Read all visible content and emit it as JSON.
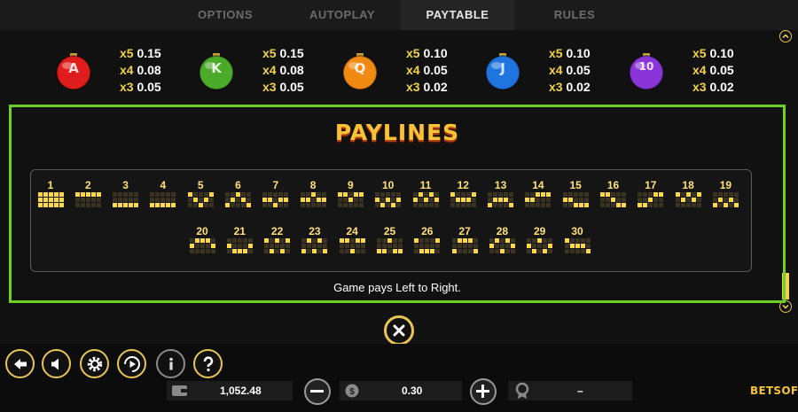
{
  "tabs": [
    {
      "label": "OPTIONS",
      "active": false
    },
    {
      "label": "AUTOPLAY",
      "active": false
    },
    {
      "label": "PAYTABLE",
      "active": true
    },
    {
      "label": "RULES",
      "active": false
    }
  ],
  "symbols": [
    {
      "icon": "red-ornament-a-icon",
      "color": "#e01d1d",
      "letter": "A",
      "pays": [
        {
          "mult": "x5",
          "value": "0.15"
        },
        {
          "mult": "x4",
          "value": "0.08"
        },
        {
          "mult": "x3",
          "value": "0.05"
        }
      ]
    },
    {
      "icon": "green-ornament-k-icon",
      "color": "#4caa2a",
      "letter": "K",
      "pays": [
        {
          "mult": "x5",
          "value": "0.15"
        },
        {
          "mult": "x4",
          "value": "0.08"
        },
        {
          "mult": "x3",
          "value": "0.05"
        }
      ]
    },
    {
      "icon": "orange-ornament-q-icon",
      "color": "#f08a12",
      "letter": "Q",
      "pays": [
        {
          "mult": "x5",
          "value": "0.10"
        },
        {
          "mult": "x4",
          "value": "0.05"
        },
        {
          "mult": "x3",
          "value": "0.02"
        }
      ]
    },
    {
      "icon": "blue-ornament-j-icon",
      "color": "#1f74e0",
      "letter": "J",
      "pays": [
        {
          "mult": "x5",
          "value": "0.10"
        },
        {
          "mult": "x4",
          "value": "0.05"
        },
        {
          "mult": "x3",
          "value": "0.02"
        }
      ]
    },
    {
      "icon": "purple-ornament-10-icon",
      "color": "#8a35d8",
      "letter": "10",
      "pays": [
        {
          "mult": "x5",
          "value": "0.10"
        },
        {
          "mult": "x4",
          "value": "0.05"
        },
        {
          "mult": "x3",
          "value": "0.02"
        }
      ]
    }
  ],
  "paylines_title": "PAYLINES",
  "paylines": [
    {
      "n": "1",
      "rows": [
        1,
        1,
        1,
        1,
        1
      ]
    },
    {
      "n": "2",
      "rows": [
        0,
        0,
        0,
        0,
        0
      ]
    },
    {
      "n": "3",
      "rows": [
        2,
        2,
        2,
        2,
        2
      ]
    },
    {
      "n": "4",
      "rows": [
        2,
        2,
        2,
        2,
        2
      ]
    },
    {
      "n": "5",
      "rows": [
        0,
        1,
        2,
        1,
        0
      ]
    },
    {
      "n": "6",
      "rows": [
        2,
        1,
        0,
        1,
        2
      ]
    },
    {
      "n": "7",
      "rows": [
        1,
        1,
        2,
        1,
        1
      ]
    },
    {
      "n": "8",
      "rows": [
        1,
        1,
        0,
        1,
        1
      ]
    },
    {
      "n": "9",
      "rows": [
        0,
        0,
        1,
        0,
        0
      ]
    },
    {
      "n": "10",
      "rows": [
        1,
        2,
        1,
        2,
        1
      ]
    },
    {
      "n": "11",
      "rows": [
        1,
        0,
        1,
        0,
        1
      ]
    },
    {
      "n": "12",
      "rows": [
        0,
        1,
        1,
        1,
        0
      ]
    },
    {
      "n": "13",
      "rows": [
        2,
        1,
        1,
        1,
        2
      ]
    },
    {
      "n": "14",
      "rows": [
        1,
        1,
        0,
        0,
        0
      ]
    },
    {
      "n": "15",
      "rows": [
        1,
        1,
        2,
        2,
        2
      ]
    },
    {
      "n": "16",
      "rows": [
        0,
        0,
        1,
        2,
        2
      ]
    },
    {
      "n": "17",
      "rows": [
        2,
        2,
        1,
        0,
        0
      ]
    },
    {
      "n": "18",
      "rows": [
        0,
        1,
        0,
        1,
        0
      ]
    },
    {
      "n": "19",
      "rows": [
        2,
        1,
        2,
        1,
        2
      ]
    },
    {
      "n": "20",
      "rows": [
        1,
        0,
        0,
        0,
        1
      ]
    },
    {
      "n": "21",
      "rows": [
        1,
        2,
        2,
        2,
        1
      ]
    },
    {
      "n": "22",
      "rows": [
        0,
        2,
        0,
        2,
        0
      ]
    },
    {
      "n": "23",
      "rows": [
        2,
        0,
        2,
        0,
        2
      ]
    },
    {
      "n": "24",
      "rows": [
        0,
        0,
        2,
        0,
        0
      ]
    },
    {
      "n": "25",
      "rows": [
        2,
        2,
        0,
        2,
        2
      ]
    },
    {
      "n": "26",
      "rows": [
        0,
        2,
        2,
        2,
        0
      ]
    },
    {
      "n": "27",
      "rows": [
        2,
        0,
        0,
        0,
        2
      ]
    },
    {
      "n": "28",
      "rows": [
        1,
        0,
        2,
        0,
        1
      ]
    },
    {
      "n": "29",
      "rows": [
        1,
        2,
        0,
        2,
        1
      ]
    },
    {
      "n": "30",
      "rows": [
        0,
        1,
        1,
        1,
        2
      ]
    }
  ],
  "footnote": "Game pays Left to Right.",
  "balance": "1,052.48",
  "bet": "0.30",
  "win": "–",
  "logo": "BETSOFT",
  "colors": {
    "accent": "#f2d24d",
    "frame": "#6ecf24"
  }
}
